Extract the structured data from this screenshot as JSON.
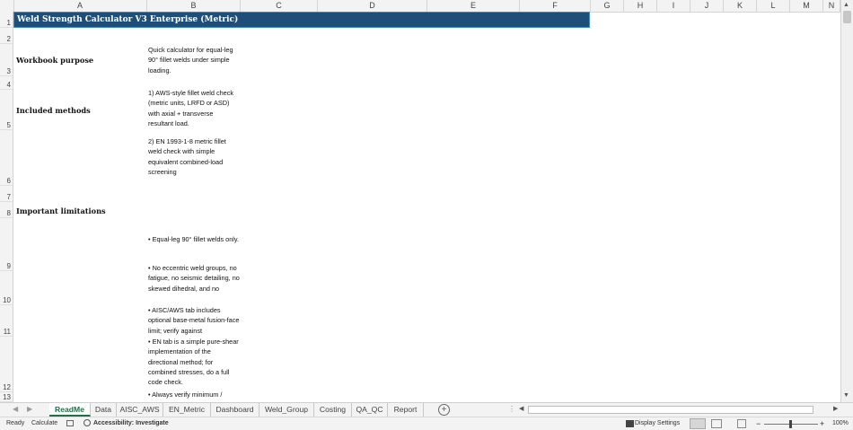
{
  "sheet": {
    "columns": [
      "A",
      "B",
      "C",
      "D",
      "E",
      "F",
      "G",
      "H",
      "I",
      "J",
      "K",
      "L",
      "M",
      "N"
    ],
    "rows": [
      "1",
      "2",
      "3",
      "4",
      "5",
      "6",
      "7",
      "8",
      "9",
      "10",
      "11",
      "12",
      "13"
    ],
    "title": "Weld Strength Calculator V3 Enterprise (Metric)",
    "labels": {
      "purpose": "Workbook purpose",
      "methods": "Included methods",
      "limitations": "Important limitations"
    },
    "cells": {
      "b3": "Quick calculator for equal-leg 90° fillet welds under simple loading.",
      "b5": "1) AWS-style fillet weld check (metric units, LRFD or ASD) with axial + transverse resultant load.",
      "b6": "2) EN 1993-1-8 metric fillet weld check with simple equivalent combined-load screening",
      "b9": "• Equal-leg 90° fillet welds only.",
      "b10": "• No eccentric weld groups, no fatigue, no seismic detailing, no skewed dihedral, and no",
      "b11": "• AISC/AWS tab includes optional base-metal fusion-face limit; verify against",
      "b12": "• EN tab is a simple pure-shear implementation of the directional method; for combined stresses, do a full code check.",
      "b13": "• Always verify minimum /"
    }
  },
  "tabs": [
    "ReadMe",
    "Data",
    "AISC_AWS",
    "EN_Metric",
    "Dashboard",
    "Weld_Group",
    "Costing",
    "QA_QC",
    "Report"
  ],
  "active_tab": "ReadMe",
  "status": {
    "ready": "Ready",
    "calculate": "Calculate",
    "accessibility": "Accessibility: Investigate",
    "display_settings": "Display Settings",
    "zoom": "100%"
  },
  "colors": {
    "title_band": "#1f4e79",
    "active_tab": "#1e7145"
  }
}
